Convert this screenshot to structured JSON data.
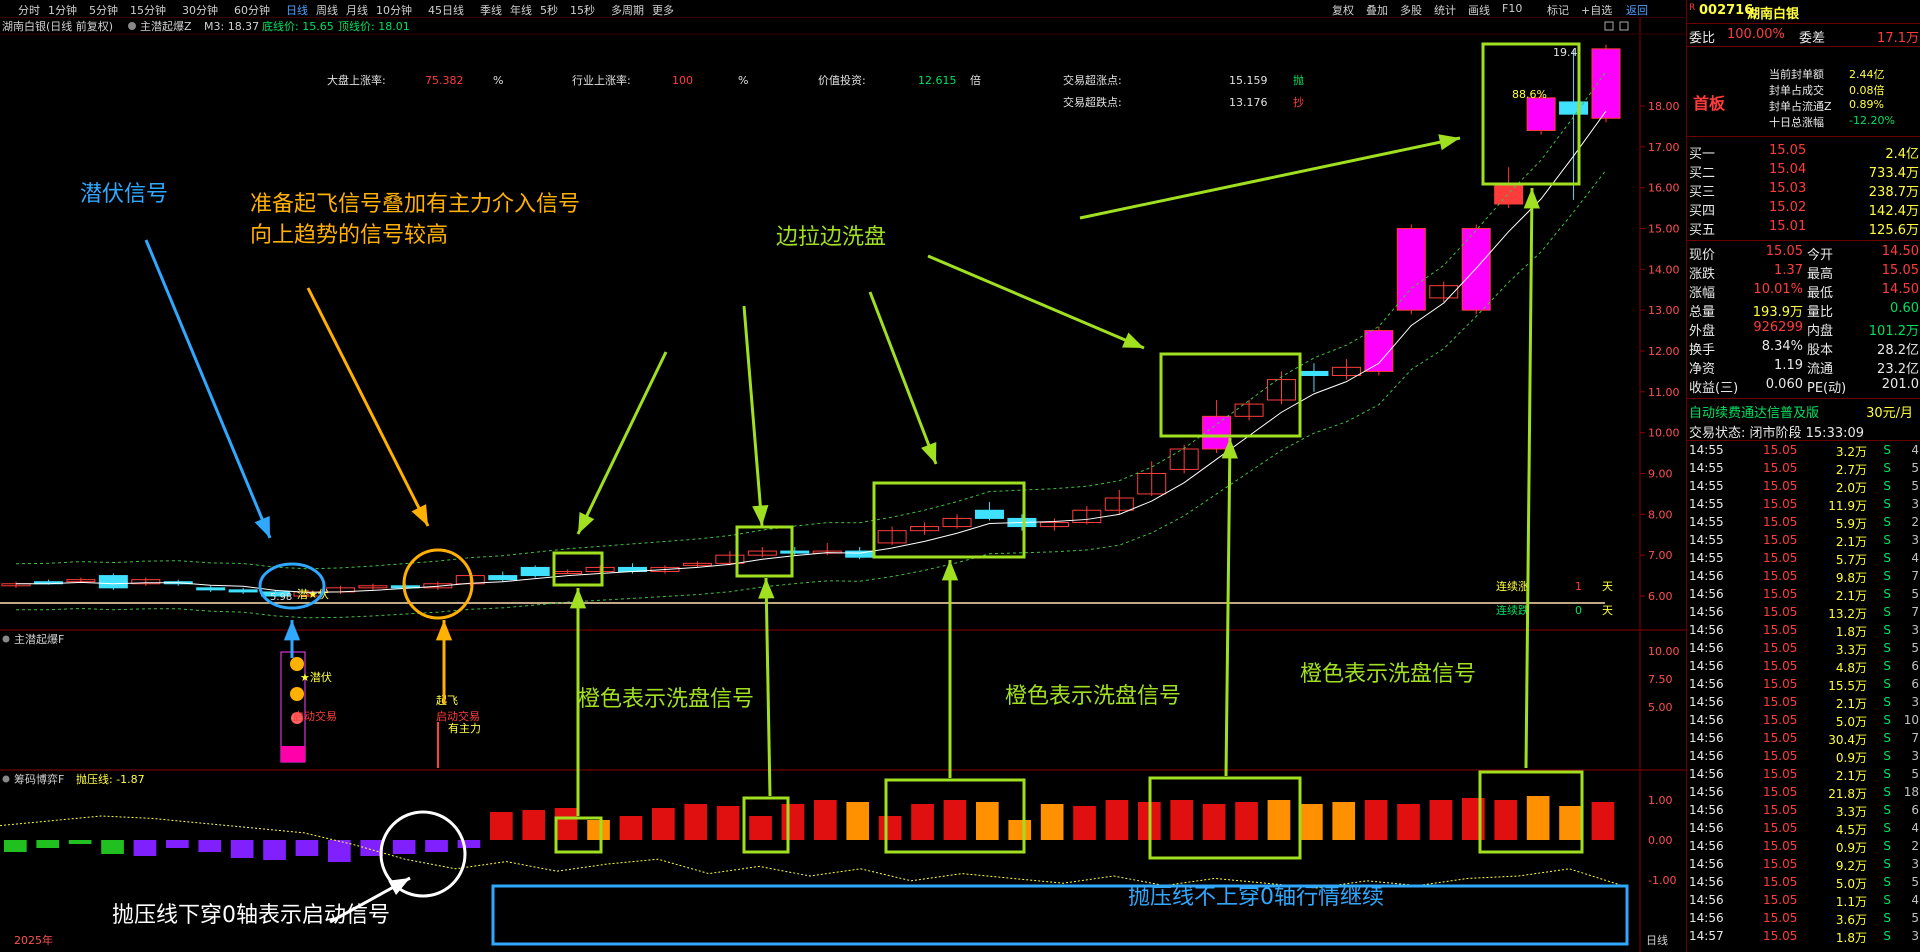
{
  "toolbar": {
    "left_tabs": [
      "分时",
      "1分钟",
      "5分钟",
      "15分钟",
      "30分钟",
      "60分钟",
      "日线",
      "周线",
      "月线",
      "10分钟",
      "45日线",
      "季线",
      "年线",
      "5秒",
      "15秒",
      "多周期",
      "更多"
    ],
    "active_tab": "日线",
    "right_items": [
      "复权",
      "叠加",
      "多股",
      "统计",
      "画线",
      "F10",
      "标记",
      "+自选",
      "返回"
    ]
  },
  "main_chart": {
    "header_stock": "湖南白银(日线 前复权)",
    "indicator_name": "主潜起爆Z",
    "m3": "M3: 18.37",
    "bottom_price": "底线价: 15.65",
    "top_price": "顶线价: 18.01",
    "stats": [
      {
        "label": "大盘上涨率:",
        "value": "75.382",
        "unit": "%"
      },
      {
        "label": "行业上涨率:",
        "value": "100",
        "unit": "%"
      },
      {
        "label": "价值投资:",
        "value": "12.615",
        "unit": "倍"
      },
      {
        "label": "交易超涨点:",
        "value": "15.159",
        "unit": "抛"
      },
      {
        "label": "交易超跌点:",
        "value": "13.176",
        "unit": "抄"
      }
    ],
    "y_ticks": [
      "18.00",
      "17.00",
      "16.00",
      "15.00",
      "14.00",
      "13.00",
      "12.00",
      "11.00",
      "10.00",
      "9.00",
      "8.00",
      "7.00",
      "6.00"
    ],
    "peak_label": "19.4",
    "pct_label": "88.6%",
    "low_label": "5.98",
    "qian_marker": "潜★伏",
    "qifei_marker": "起飞",
    "lianxu_zhang": "连续涨",
    "lianxu_die": "连续跌",
    "lianxu_zhang_val": "1",
    "lianxu_die_val": "0",
    "tian": "天"
  },
  "indicator_1": {
    "title": "主潜起爆F",
    "y_ticks": [
      "10.00",
      "7.50",
      "5.00"
    ],
    "qianfu": "★潜伏",
    "qidong": "启动交易",
    "qifei": "起飞",
    "qidong2": "启动交易",
    "youzhuli": "有主力"
  },
  "indicator_2": {
    "title": "筹码博弈F",
    "paoya": "抛压线: -1.87",
    "y_ticks": [
      "1.00",
      "0.00",
      "-1.00"
    ],
    "x_label": "2025年",
    "period": "日线"
  },
  "annotations": {
    "qianfu_signal": "潜伏信号",
    "prepare_line1": "准备起飞信号叠加有主力介入信号",
    "prepare_line2": "向上趋势的信号较高",
    "bianla": "边拉边洗盘",
    "orange_1": "橙色表示洗盘信号",
    "orange_2": "橙色表示洗盘信号",
    "orange_3": "橙色表示洗盘信号",
    "paoya_cross": "抛压线下穿0轴表示启动信号",
    "paoya_not": "抛压线不上穿0轴行情继续"
  },
  "sidebar": {
    "code": "002716",
    "name": "湖南白银",
    "r_badge": "R",
    "weibi_label": "委比",
    "weibi": "100.00%",
    "weicha_label": "委差",
    "weicha": "17.1万",
    "shouban": "首板",
    "seal_lines": [
      {
        "label": "当前封单额",
        "value": "2.44亿"
      },
      {
        "label": "封单占成交",
        "value": "0.08倍"
      },
      {
        "label": "封单占流通Z",
        "value": "0.89%"
      },
      {
        "label": "十日总涨幅",
        "value": "-12.20%"
      }
    ],
    "buy": [
      {
        "label": "买一",
        "price": "15.05",
        "vol": "2.4亿"
      },
      {
        "label": "买二",
        "price": "15.04",
        "vol": "733.4万"
      },
      {
        "label": "买三",
        "price": "15.03",
        "vol": "238.7万"
      },
      {
        "label": "买四",
        "price": "15.02",
        "vol": "142.4万"
      },
      {
        "label": "买五",
        "price": "15.01",
        "vol": "125.6万"
      }
    ],
    "quote": [
      {
        "l1": "现价",
        "v1": "15.05",
        "l2": "今开",
        "v2": "14.50",
        "c1": "red",
        "c2": "red"
      },
      {
        "l1": "涨跌",
        "v1": "1.37",
        "l2": "最高",
        "v2": "15.05",
        "c1": "red",
        "c2": "red"
      },
      {
        "l1": "涨幅",
        "v1": "10.01%",
        "l2": "最低",
        "v2": "14.50",
        "c1": "red",
        "c2": "red"
      },
      {
        "l1": "总量",
        "v1": "193.9万",
        "l2": "量比",
        "v2": "0.60",
        "c1": "yellow",
        "c2": "green"
      },
      {
        "l1": "外盘",
        "v1": "926299",
        "l2": "内盘",
        "v2": "101.2万",
        "c1": "red",
        "c2": "green"
      },
      {
        "l1": "换手",
        "v1": "8.34%",
        "l2": "股本",
        "v2": "28.2亿",
        "c1": "white",
        "c2": "white"
      },
      {
        "l1": "净资",
        "v1": "1.19",
        "l2": "流通",
        "v2": "23.2亿",
        "c1": "white",
        "c2": "white"
      },
      {
        "l1": "收益(三)",
        "v1": "0.060",
        "l2": "PE(动)",
        "v2": "201.0",
        "c1": "white",
        "c2": "white"
      }
    ],
    "ad_text": "自动续费通达信普及版",
    "ad_price": "30元/月",
    "trade_state": "交易状态: 闭市阶段 15:33:09",
    "ticks": [
      {
        "t": "14:55",
        "p": "15.05",
        "v": "3.2万",
        "s": "S",
        "n": "4"
      },
      {
        "t": "14:55",
        "p": "15.05",
        "v": "2.7万",
        "s": "S",
        "n": "5"
      },
      {
        "t": "14:55",
        "p": "15.05",
        "v": "2.0万",
        "s": "S",
        "n": "5"
      },
      {
        "t": "14:55",
        "p": "15.05",
        "v": "11.9万",
        "s": "S",
        "n": "3"
      },
      {
        "t": "14:55",
        "p": "15.05",
        "v": "5.9万",
        "s": "S",
        "n": "2"
      },
      {
        "t": "14:55",
        "p": "15.05",
        "v": "2.1万",
        "s": "S",
        "n": "3"
      },
      {
        "t": "14:55",
        "p": "15.05",
        "v": "5.7万",
        "s": "S",
        "n": "4"
      },
      {
        "t": "14:56",
        "p": "15.05",
        "v": "9.8万",
        "s": "S",
        "n": "7"
      },
      {
        "t": "14:56",
        "p": "15.05",
        "v": "2.1万",
        "s": "S",
        "n": "5"
      },
      {
        "t": "14:56",
        "p": "15.05",
        "v": "13.2万",
        "s": "S",
        "n": "7"
      },
      {
        "t": "14:56",
        "p": "15.05",
        "v": "1.8万",
        "s": "S",
        "n": "3"
      },
      {
        "t": "14:56",
        "p": "15.05",
        "v": "3.3万",
        "s": "S",
        "n": "5"
      },
      {
        "t": "14:56",
        "p": "15.05",
        "v": "4.8万",
        "s": "S",
        "n": "6"
      },
      {
        "t": "14:56",
        "p": "15.05",
        "v": "15.5万",
        "s": "S",
        "n": "6"
      },
      {
        "t": "14:56",
        "p": "15.05",
        "v": "2.1万",
        "s": "S",
        "n": "3"
      },
      {
        "t": "14:56",
        "p": "15.05",
        "v": "5.0万",
        "s": "S",
        "n": "10"
      },
      {
        "t": "14:56",
        "p": "15.05",
        "v": "30.4万",
        "s": "S",
        "n": "7"
      },
      {
        "t": "14:56",
        "p": "15.05",
        "v": "0.9万",
        "s": "S",
        "n": "3"
      },
      {
        "t": "14:56",
        "p": "15.05",
        "v": "2.1万",
        "s": "S",
        "n": "5"
      },
      {
        "t": "14:56",
        "p": "15.05",
        "v": "21.8万",
        "s": "S",
        "n": "18"
      },
      {
        "t": "14:56",
        "p": "15.05",
        "v": "3.3万",
        "s": "S",
        "n": "6"
      },
      {
        "t": "14:56",
        "p": "15.05",
        "v": "4.5万",
        "s": "S",
        "n": "4"
      },
      {
        "t": "14:56",
        "p": "15.05",
        "v": "0.9万",
        "s": "S",
        "n": "2"
      },
      {
        "t": "14:56",
        "p": "15.05",
        "v": "9.2万",
        "s": "S",
        "n": "3"
      },
      {
        "t": "14:56",
        "p": "15.05",
        "v": "5.0万",
        "s": "S",
        "n": "5"
      },
      {
        "t": "14:56",
        "p": "15.05",
        "v": "1.1万",
        "s": "S",
        "n": "4"
      },
      {
        "t": "14:56",
        "p": "15.05",
        "v": "3.6万",
        "s": "S",
        "n": "5"
      },
      {
        "t": "14:57",
        "p": "15.05",
        "v": "1.8万",
        "s": "S",
        "n": "3"
      }
    ]
  },
  "colors": {
    "up": "#ff3c3c",
    "down": "#40e0ff",
    "magenta": "#ff00ff",
    "green_box": "#a0e020",
    "blue_box": "#30a8ff",
    "orange": "#ffb000",
    "axis": "#8a0000"
  },
  "chart_data": {
    "type": "candlestick",
    "candles": [
      {
        "o": 6.25,
        "c": 6.3,
        "h": 6.35,
        "l": 6.2
      },
      {
        "o": 6.35,
        "c": 6.3,
        "h": 6.4,
        "l": 6.28
      },
      {
        "o": 6.38,
        "c": 6.4,
        "h": 6.45,
        "l": 6.35
      },
      {
        "o": 6.5,
        "c": 6.2,
        "h": 6.55,
        "l": 6.15
      },
      {
        "o": 6.3,
        "c": 6.4,
        "h": 6.45,
        "l": 6.25
      },
      {
        "o": 6.35,
        "c": 6.3,
        "h": 6.4,
        "l": 6.25
      },
      {
        "o": 6.2,
        "c": 6.15,
        "h": 6.25,
        "l": 6.1
      },
      {
        "o": 6.15,
        "c": 6.1,
        "h": 6.2,
        "l": 6.05
      },
      {
        "o": 6.1,
        "c": 6.0,
        "h": 6.15,
        "l": 5.98
      },
      {
        "o": 6.0,
        "c": 6.1,
        "h": 6.15,
        "l": 5.98
      },
      {
        "o": 6.1,
        "c": 6.2,
        "h": 6.25,
        "l": 6.05
      },
      {
        "o": 6.2,
        "c": 6.25,
        "h": 6.3,
        "l": 6.15
      },
      {
        "o": 6.25,
        "c": 6.2,
        "h": 6.3,
        "l": 6.15
      },
      {
        "o": 6.2,
        "c": 6.3,
        "h": 6.35,
        "l": 6.15
      },
      {
        "o": 6.3,
        "c": 6.5,
        "h": 6.6,
        "l": 6.25
      },
      {
        "o": 6.5,
        "c": 6.4,
        "h": 6.6,
        "l": 6.35
      },
      {
        "o": 6.7,
        "c": 6.5,
        "h": 6.75,
        "l": 6.45
      },
      {
        "o": 6.6,
        "c": 6.6,
        "h": 6.65,
        "l": 6.55
      },
      {
        "o": 6.6,
        "c": 6.7,
        "h": 6.75,
        "l": 6.55
      },
      {
        "o": 6.7,
        "c": 6.6,
        "h": 6.8,
        "l": 6.55
      },
      {
        "o": 6.6,
        "c": 6.7,
        "h": 6.75,
        "l": 6.55
      },
      {
        "o": 6.75,
        "c": 6.8,
        "h": 6.85,
        "l": 6.7
      },
      {
        "o": 6.8,
        "c": 7.0,
        "h": 7.1,
        "l": 6.75
      },
      {
        "o": 7.0,
        "c": 7.1,
        "h": 7.2,
        "l": 6.95
      },
      {
        "o": 7.1,
        "c": 7.05,
        "h": 7.2,
        "l": 7.0
      },
      {
        "o": 7.05,
        "c": 7.1,
        "h": 7.3,
        "l": 7.0
      },
      {
        "o": 7.1,
        "c": 6.95,
        "h": 7.2,
        "l": 6.9
      },
      {
        "o": 7.3,
        "c": 7.6,
        "h": 7.7,
        "l": 7.25
      },
      {
        "o": 7.6,
        "c": 7.7,
        "h": 7.8,
        "l": 7.5
      },
      {
        "o": 7.7,
        "c": 7.9,
        "h": 8.0,
        "l": 7.65
      },
      {
        "o": 8.1,
        "c": 7.9,
        "h": 8.3,
        "l": 7.85
      },
      {
        "o": 7.9,
        "c": 7.7,
        "h": 8.0,
        "l": 7.6
      },
      {
        "o": 7.7,
        "c": 7.8,
        "h": 7.9,
        "l": 7.6
      },
      {
        "o": 7.8,
        "c": 8.1,
        "h": 8.2,
        "l": 7.75
      },
      {
        "o": 8.1,
        "c": 8.4,
        "h": 8.6,
        "l": 8.0
      },
      {
        "o": 8.5,
        "c": 9.0,
        "h": 9.3,
        "l": 8.45
      },
      {
        "o": 9.1,
        "c": 9.6,
        "h": 9.7,
        "l": 9.0
      },
      {
        "o": 9.6,
        "c": 10.4,
        "h": 10.8,
        "l": 9.5
      },
      {
        "o": 10.4,
        "c": 10.7,
        "h": 10.8,
        "l": 10.3
      },
      {
        "o": 10.8,
        "c": 11.3,
        "h": 11.5,
        "l": 10.7
      },
      {
        "o": 11.5,
        "c": 11.4,
        "h": 11.7,
        "l": 11.0
      },
      {
        "o": 11.4,
        "c": 11.6,
        "h": 11.8,
        "l": 11.3
      },
      {
        "o": 11.5,
        "c": 12.5,
        "h": 12.6,
        "l": 11.4
      },
      {
        "o": 13.0,
        "c": 15.0,
        "h": 15.1,
        "l": 12.9
      },
      {
        "o": 13.3,
        "c": 13.6,
        "h": 13.7,
        "l": 13.2
      },
      {
        "o": 13.0,
        "c": 15.0,
        "h": 15.1,
        "l": 12.9
      },
      {
        "o": 15.6,
        "c": 16.1,
        "h": 16.5,
        "l": 15.5
      },
      {
        "o": 17.4,
        "c": 18.2,
        "h": 18.3,
        "l": 17.3
      },
      {
        "o": 18.1,
        "c": 17.8,
        "h": 19.4,
        "l": 15.7
      },
      {
        "o": 17.7,
        "c": 19.4,
        "h": 19.5,
        "l": 17.6
      }
    ],
    "ylim": [
      5.6,
      19.6
    ],
    "volume_bars": [
      -0.3,
      -0.2,
      -0.1,
      -0.35,
      -0.4,
      -0.2,
      -0.3,
      -0.45,
      -0.5,
      -0.4,
      -0.55,
      -0.4,
      -0.35,
      -0.3,
      -0.2,
      0.7,
      0.75,
      0.8,
      0.5,
      0.6,
      0.8,
      0.9,
      0.85,
      0.6,
      0.9,
      1.0,
      0.95,
      0.6,
      0.9,
      1.0,
      0.95,
      0.5,
      0.9,
      0.85,
      1.0,
      0.95,
      1.0,
      0.9,
      0.95,
      1.0,
      0.9,
      0.95,
      1.0,
      0.9,
      1.0,
      1.05,
      1.0,
      1.1,
      0.85,
      0.95
    ],
    "paoya_line": [
      0.6,
      0.8,
      1.0,
      0.9,
      0.7,
      0.5,
      0.3,
      -0.2,
      -0.8,
      -1.2,
      -0.9,
      -1.3,
      -1.0,
      -0.8,
      -1.4,
      -1.1,
      -1.5,
      -1.2,
      -1.7,
      -1.4,
      -1.6,
      -1.8,
      -1.5,
      -1.9,
      -1.6,
      -1.8,
      -2.0,
      -1.7,
      -1.9,
      -1.6,
      -1.5,
      -1.2,
      -1.87
    ],
    "xlabel": "2025年"
  }
}
